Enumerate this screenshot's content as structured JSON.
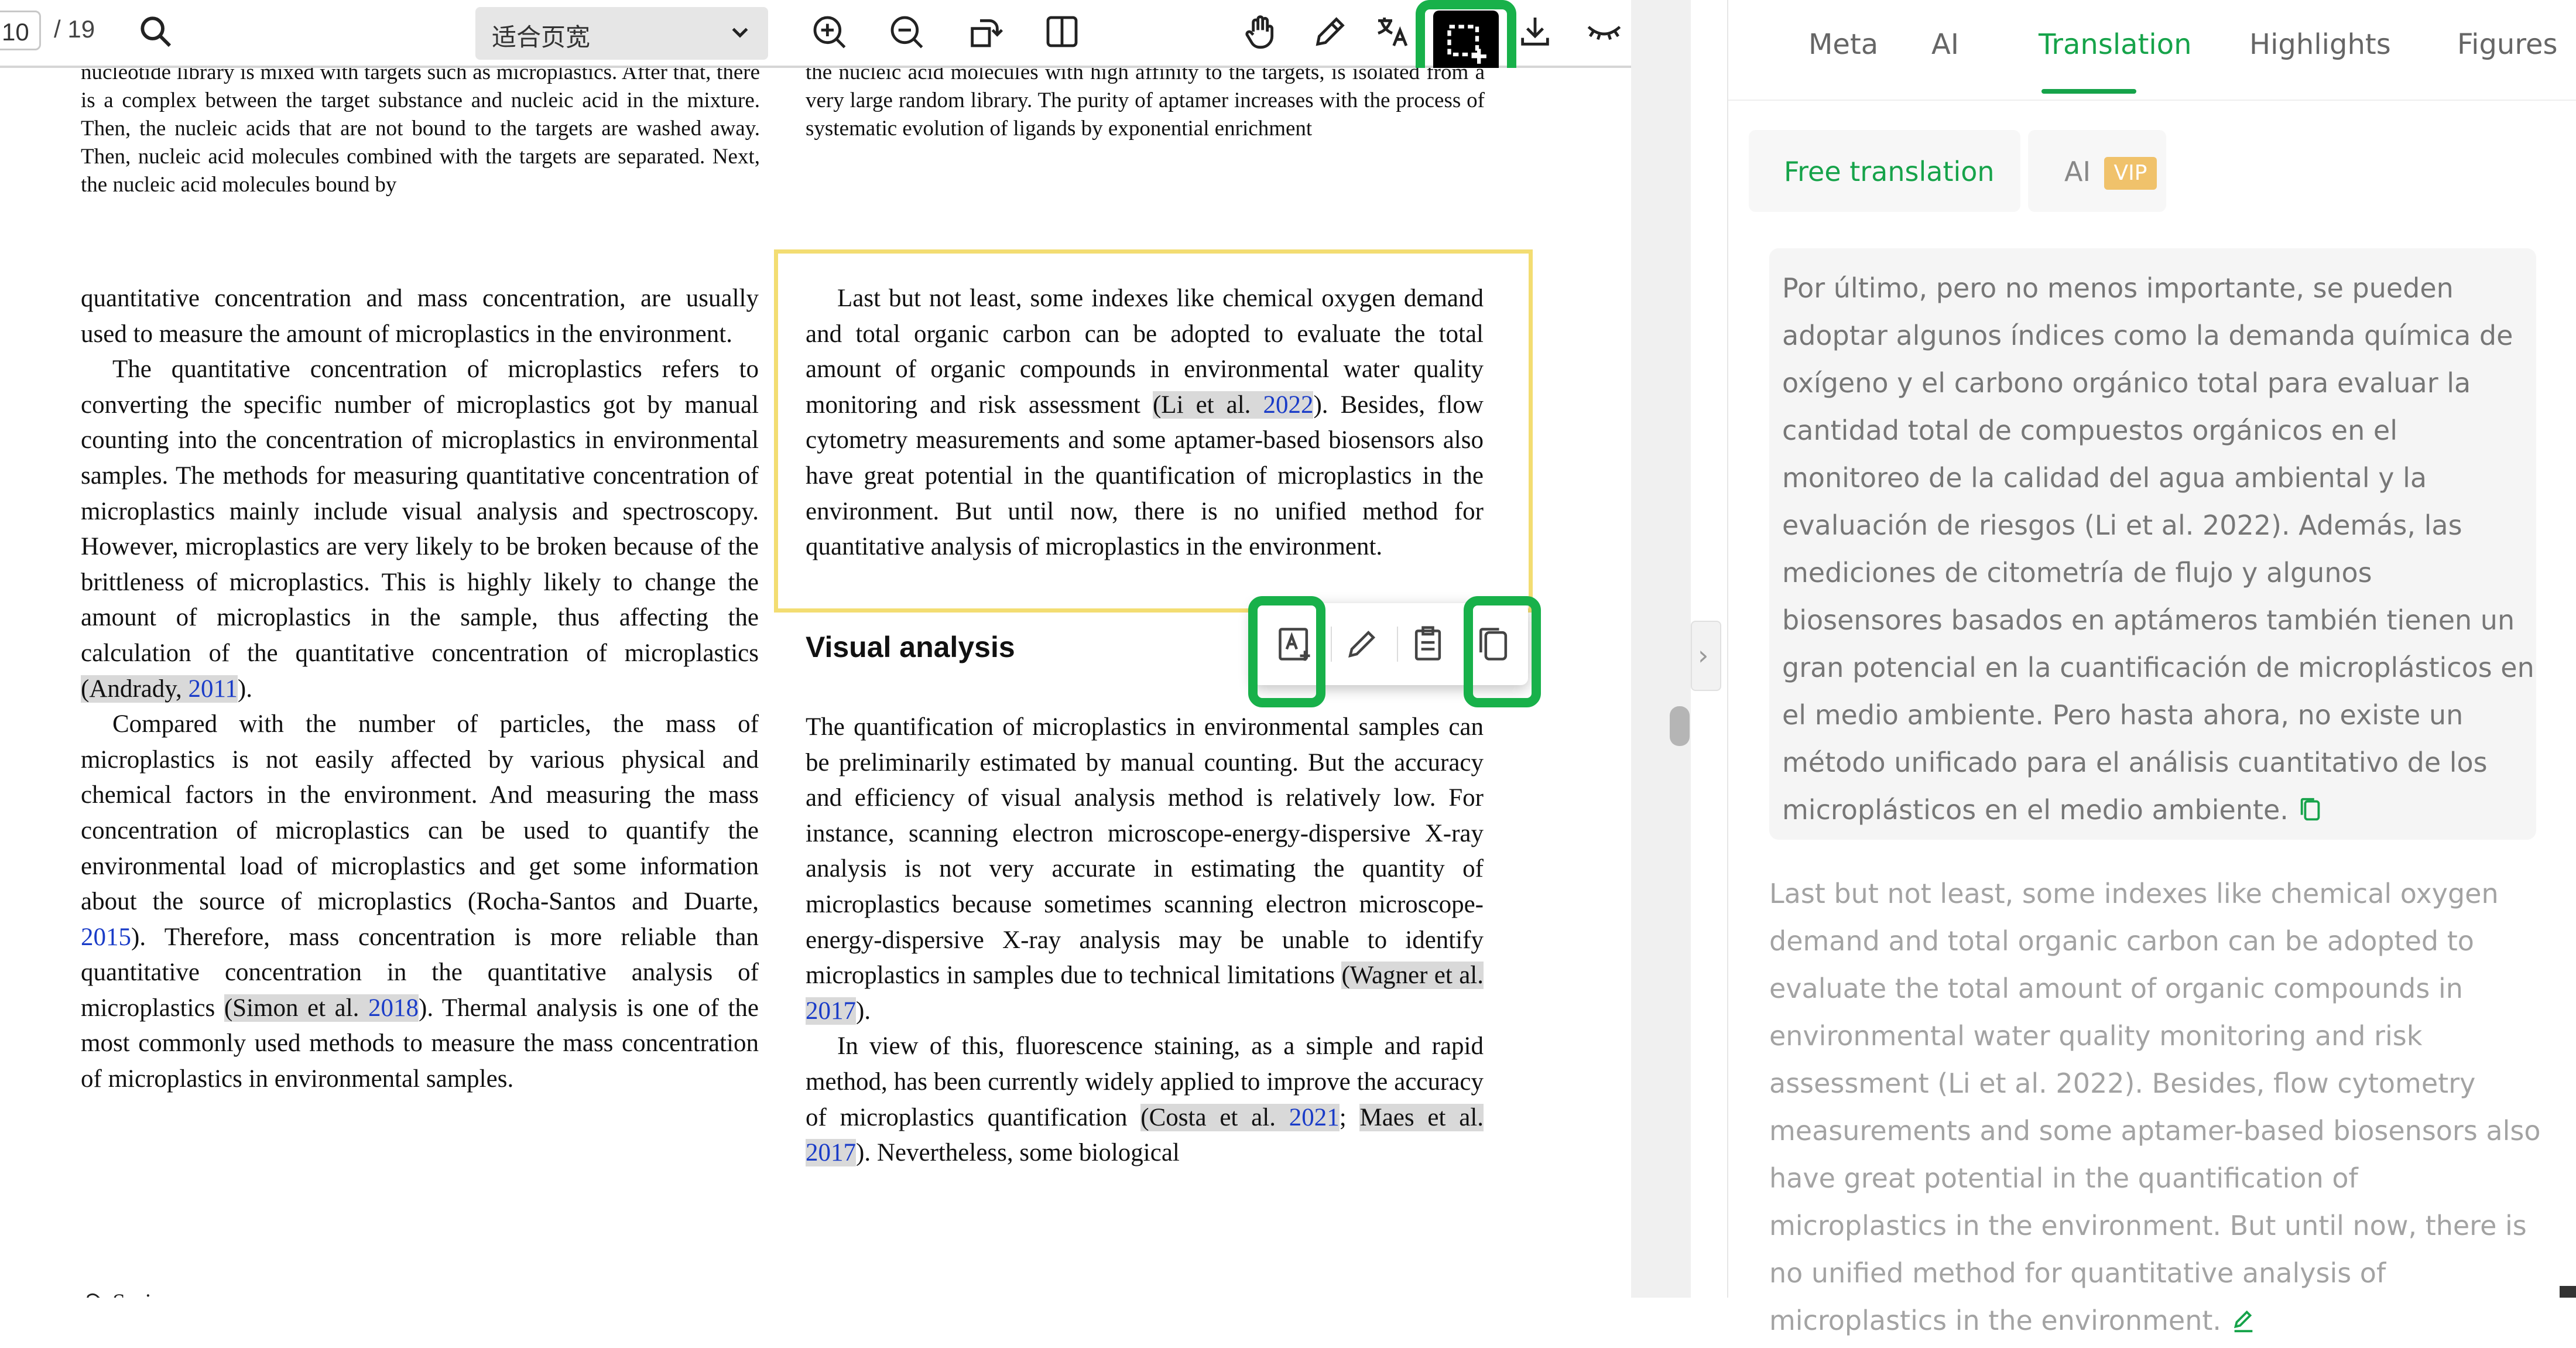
{
  "toolbar": {
    "page_current": "10",
    "page_total": "/ 19",
    "zoom_value": "适合页宽",
    "icons": [
      "search-icon",
      "zoom-in-icon",
      "zoom-out-icon",
      "rotate-icon",
      "split-view-icon",
      "hand-icon",
      "pen-icon",
      "translate-icon",
      "area-select-icon",
      "download-icon",
      "eye-closed-icon"
    ]
  },
  "doc": {
    "left_top_fragment": "nucleotide library is mixed with targets such as microplastics. After that, there is a complex between the target substance and nucleic acid in the mixture. Then, the nucleic acids that are not bound to the targets are washed away. Then, nucleic acid molecules combined with the targets are separated. Next, the nucleic acid molecules bound by",
    "right_top_fragment": "the nucleic acid molecules with high affinity to the targets, is isolated from a very large random library. The purity of aptamer increases with the process of systematic evolution of ligands by exponential enrichment",
    "left_col": {
      "p1": "quantitative concentration and mass concentration, are usually used to measure the amount of microplastics in the environment.",
      "p2": "The quantitative concentration of microplastics refers to converting the specific number of microplastics got by manual counting into the concentration of microplastics in environmental samples. The methods for measuring quantitative concentration of microplastics mainly include visual analysis and spectroscopy. However, microplastics are very likely to be broken because of the brittleness of microplastics. This is highly likely to change the amount of microplastics in the sample, thus affecting the calculation of the quantitative concentration of microplastics",
      "p2_cite_author": "(Andrady, ",
      "p2_cite_year": "2011",
      "p2_end": ").",
      "p3a": "Compared with the number of particles, the mass of microplastics is not easily affected by various physical and chemical factors in the environment. And measuring the mass concentration of microplastics can be used to quantify the environmental load of microplastics and get some information about the source of microplastics (Rocha-Santos and Duarte, ",
      "p3_year1": "2015",
      "p3b": "). Therefore, mass concentration is more reliable than quantitative concentration in the quantitative analysis of microplastics ",
      "p3_cite2_author": "(Simon et al. ",
      "p3_cite2_year": "2018",
      "p3c": "). Thermal analysis is one of the most commonly used methods to measure the mass concentration of microplastics in environmental samples."
    },
    "right_col": {
      "selected_a": "Last but not least, some indexes like chemical oxygen demand and total organic carbon can be adopted to evaluate the total amount of organic compounds in environmental water quality monitoring and risk assessment ",
      "selected_cite_author": "(Li et al. ",
      "selected_cite_year": "2022",
      "selected_b": "). Besides, flow cytometry measurements and some aptamer-based biosensors also have great potential in the quantification of microplastics in the environment. But until now, there is no unified method for quantitative analysis of microplastics in the environment.",
      "heading": "Visual analysis",
      "p1a": "The quantification of microplastics in environmental samples can be preliminarily estimated by manual counting. But the accuracy and efficiency of visual analysis method is relatively low. For instance, scanning electron microscope-energy-dispersive X-ray analysis is not very accurate in estimating the quantity of microplastics because sometimes scanning electron microscope-energy-dispersive X-ray analysis may be unable to identify microplastics in samples due to technical limitations ",
      "p1_cite_author": "(Wagner et al. ",
      "p1_cite_year": "2017",
      "p1_end": ").",
      "p2a": "In view of this, fluorescence staining, as a simple and rapid method, has been currently widely applied to improve the accuracy of microplastics quantification ",
      "p2_cite1_author": "(Costa et al. ",
      "p2_cite1_year": "2021",
      "p2_sep": "; ",
      "p2_cite2_author": "Maes et al. ",
      "p2_cite2_year": "2017",
      "p2_end": "). Nevertheless, some biological"
    },
    "footer_logo": "Springer"
  },
  "popup": {
    "icons": [
      "add-note-icon",
      "edit-icon",
      "clipboard-icon",
      "copy-icon"
    ]
  },
  "panel": {
    "tabs": [
      "Meta",
      "AI",
      "Translation",
      "Highlights",
      "Figures"
    ],
    "active_tab": "Translation",
    "subtabs": {
      "free": "Free translation",
      "ai": "AI",
      "vip": "VIP"
    },
    "translation": "Por último, pero no menos importante, se pueden adoptar algunos índices como la demanda química de oxígeno y el carbono orgánico total para evaluar la cantidad total de compuestos orgánicos en el monitoreo de la calidad del agua ambiental y la evaluación de riesgos (Li et al. 2022). Además, las mediciones de citometría de flujo y algunos biosensores basados en aptámeros también tienen un gran potencial en la cuantificación de microplásticos en el medio ambiente. Pero hasta ahora, no existe un método unificado para el análisis cuantitativo de los microplásticos en el medio ambiente.",
    "original": "Last but not least, some indexes like chemical oxygen demand and total organic carbon can be adopted to evaluate the total amount of organic compounds in environmental water quality monitoring and risk assessment (Li et al. 2022). Besides, flow cytometry measurements and some aptamer-based biosensors also have great potential in the quantification of microplastics in the environment. But until now, there is no unified method for quantitative analysis of microplastics in the environment."
  },
  "colors": {
    "accent_green": "#16a34a",
    "highlight_green_box": "#18b14a",
    "selection_yellow": "#f3dd72",
    "link_blue": "#1a3cc8"
  }
}
